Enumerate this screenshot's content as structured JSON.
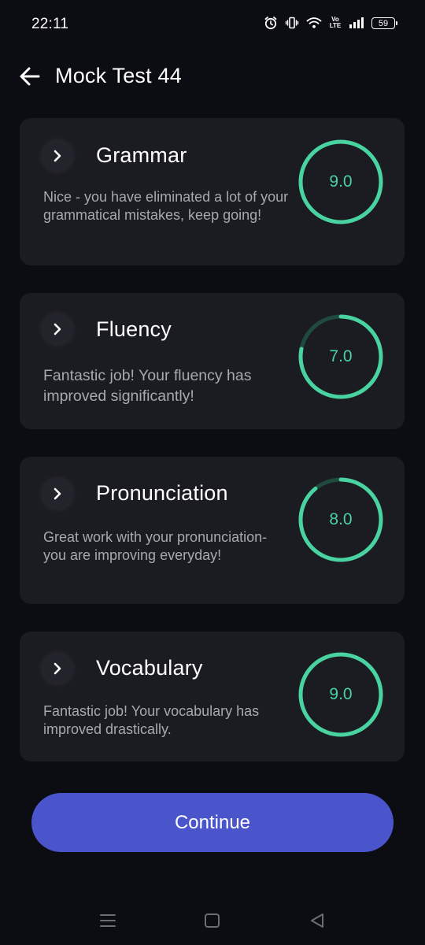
{
  "status_bar": {
    "time": "22:11",
    "volte": "Vo LTE",
    "battery": "59"
  },
  "header": {
    "title": "Mock Test 44"
  },
  "accent_color": "#49d3a1",
  "button_color": "#4a55cc",
  "cards": [
    {
      "title": "Grammar",
      "description": "Nice - you have eliminated a lot of your grammatical mistakes, keep going!",
      "score": "9.0",
      "progress": 1.0
    },
    {
      "title": "Fluency",
      "description": "Fantastic job! Your fluency has improved significantly!",
      "score": "7.0",
      "progress": 0.78
    },
    {
      "title": "Pronunciation",
      "description": "Great work with your pronunciation- you are improving everyday!",
      "score": "8.0",
      "progress": 0.89
    },
    {
      "title": "Vocabulary",
      "description": "Fantastic job! Your vocabulary has improved drastically.",
      "score": "9.0",
      "progress": 1.0
    }
  ],
  "continue_label": "Continue"
}
